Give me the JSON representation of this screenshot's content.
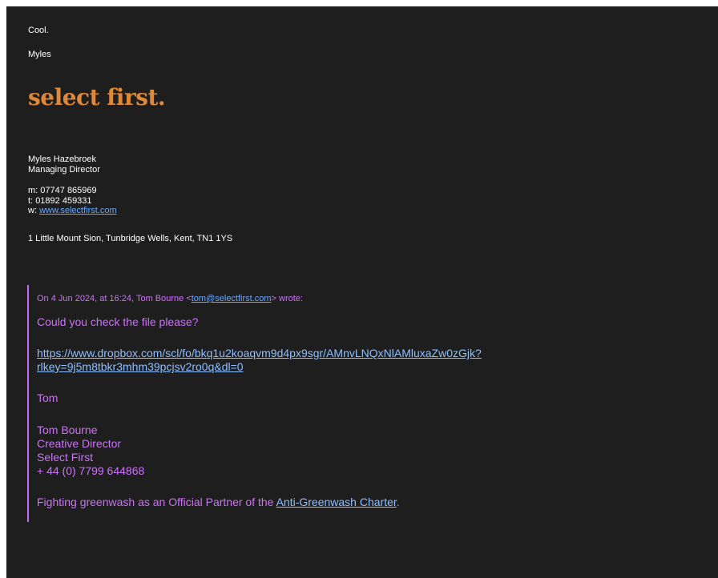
{
  "reply": {
    "greeting": "Cool.",
    "signoff": "Myles"
  },
  "signature": {
    "logo_text": "select first.",
    "logo_color": "#e0883a",
    "name": "Myles Hazebroek",
    "title": "Managing Director",
    "mobile_label": "m:",
    "mobile": "07747 865969",
    "phone_label": "t:",
    "phone": "01892 459331",
    "web_label": "w:",
    "website": "www.selectfirst.com",
    "address": "1 Little Mount Sion, Tunbridge Wells, Kent, TN1 1YS"
  },
  "quoted": {
    "header_prefix": "On 4 Jun 2024, at 16:24, Tom Bourne <",
    "sender_email": "tom@selectfirst.com",
    "header_suffix": "> wrote:",
    "body": "Could you check the file please?",
    "link_line1": "https://www.dropbox.com/scl/fo/bkq1u2koaqvm9d4px9sgr/AMnvLNQxNlAMluxaZw0zGjk?",
    "link_line2": "rlkey=9j5m8tbkr3mhm39pcjsv2ro0q&dl=0",
    "signoff": "Tom",
    "sig_name": "Tom Bourne",
    "sig_title": "Creative Director",
    "sig_company": "Select First",
    "sig_phone": "+ 44 (0) 7799 644868",
    "footer_prefix": "Fighting greenwash as an Official Partner of the ",
    "footer_link": "Anti-Greenwash Charter",
    "footer_suffix": "."
  },
  "colors": {
    "background": "#1e1e1e",
    "quote_text": "#cc73f7",
    "quote_bar": "#c86af0",
    "link": "#6aa9ff"
  }
}
